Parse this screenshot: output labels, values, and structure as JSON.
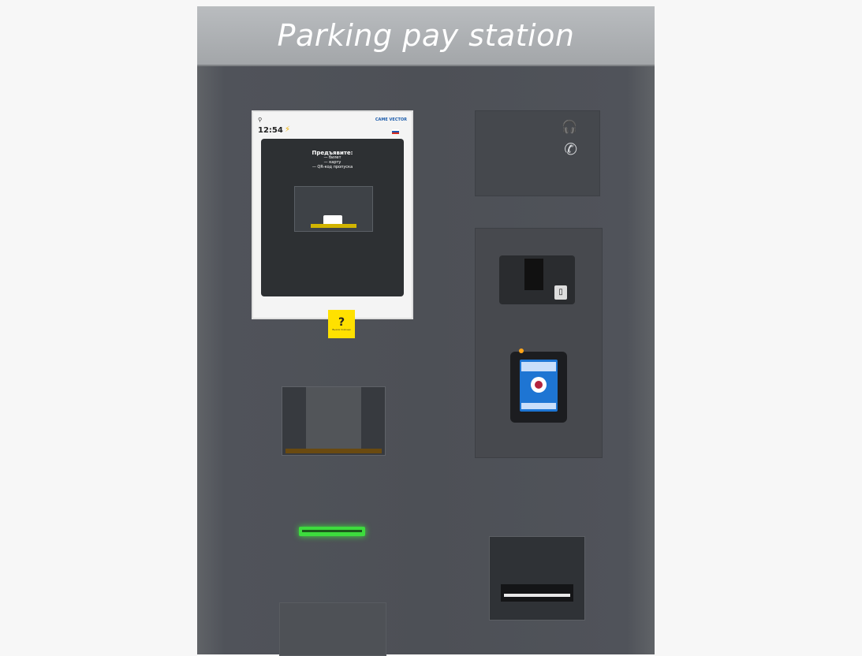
{
  "kiosk": {
    "title": "Parking pay station"
  },
  "screen": {
    "location_text": "",
    "brand": "CAME VECTOR",
    "time": "12:54",
    "prompt_title": "Предъявите:",
    "prompt_lines": [
      "— билет",
      "— карту",
      "— QR-код пропуска"
    ],
    "help_label": "Вызов помощи"
  },
  "icons": {
    "location": "location-pin-icon",
    "bolt": "lightning-icon",
    "headset": "headset-icon",
    "call": "call-icon",
    "help": "help-hand-icon",
    "card": "card-insert-icon"
  },
  "colors": {
    "accent_yellow": "#ffe100",
    "brand_blue": "#1c5cab",
    "bill_slot_green": "#3ddc3d",
    "led_orange": "#ffa51a"
  }
}
